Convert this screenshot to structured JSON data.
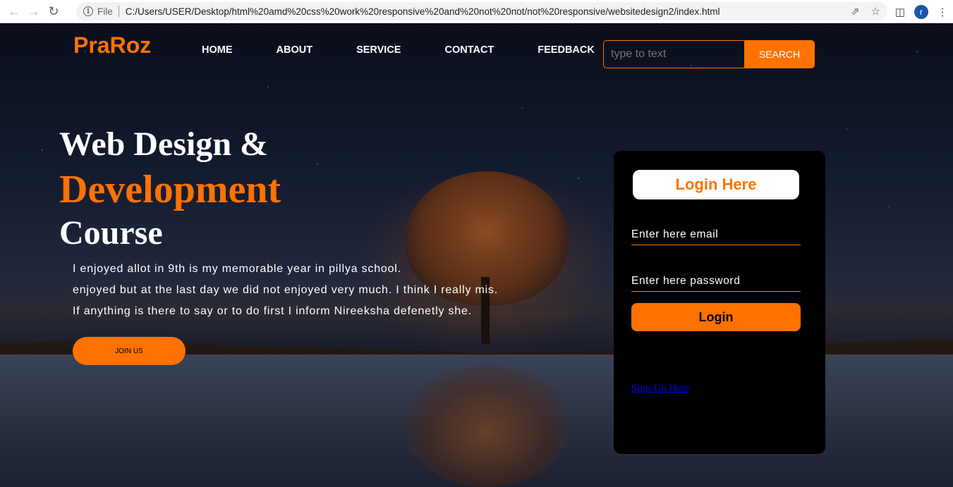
{
  "browser": {
    "file_label": "File",
    "url": "C:/Users/USER/Desktop/html%20amd%20css%20work%20responsive%20and%20not%20not/not%20responsive/websitedesign2/index.html",
    "avatar_letter": "r"
  },
  "header": {
    "logo": "PraRoz",
    "menu": [
      "HOME",
      "ABOUT",
      "SERVICE",
      "CONTACT",
      "FEEDBACK"
    ],
    "search_placeholder": "type to text",
    "search_button": "SEARCH"
  },
  "hero": {
    "title_line1": "Web Design &",
    "title_line2": "Development",
    "title_line3": "Course",
    "paragraph": [
      "I enjoyed allot in 9th is my memorable year in pillya school.",
      "enjoyed but at the last day we did not enjoyed very much. I think I really mis.",
      "If anything is there to say or to do first I inform Nireeksha defenetly she."
    ],
    "join_button": "JOIN US"
  },
  "login": {
    "title": "Login Here",
    "email_placeholder": "Enter here email",
    "password_placeholder": "Enter here password",
    "button": "Login",
    "signup_link": "Sign Up Here"
  },
  "colors": {
    "accent": "#ff7200",
    "card_bg": "#000000",
    "link": "#0000ee"
  }
}
